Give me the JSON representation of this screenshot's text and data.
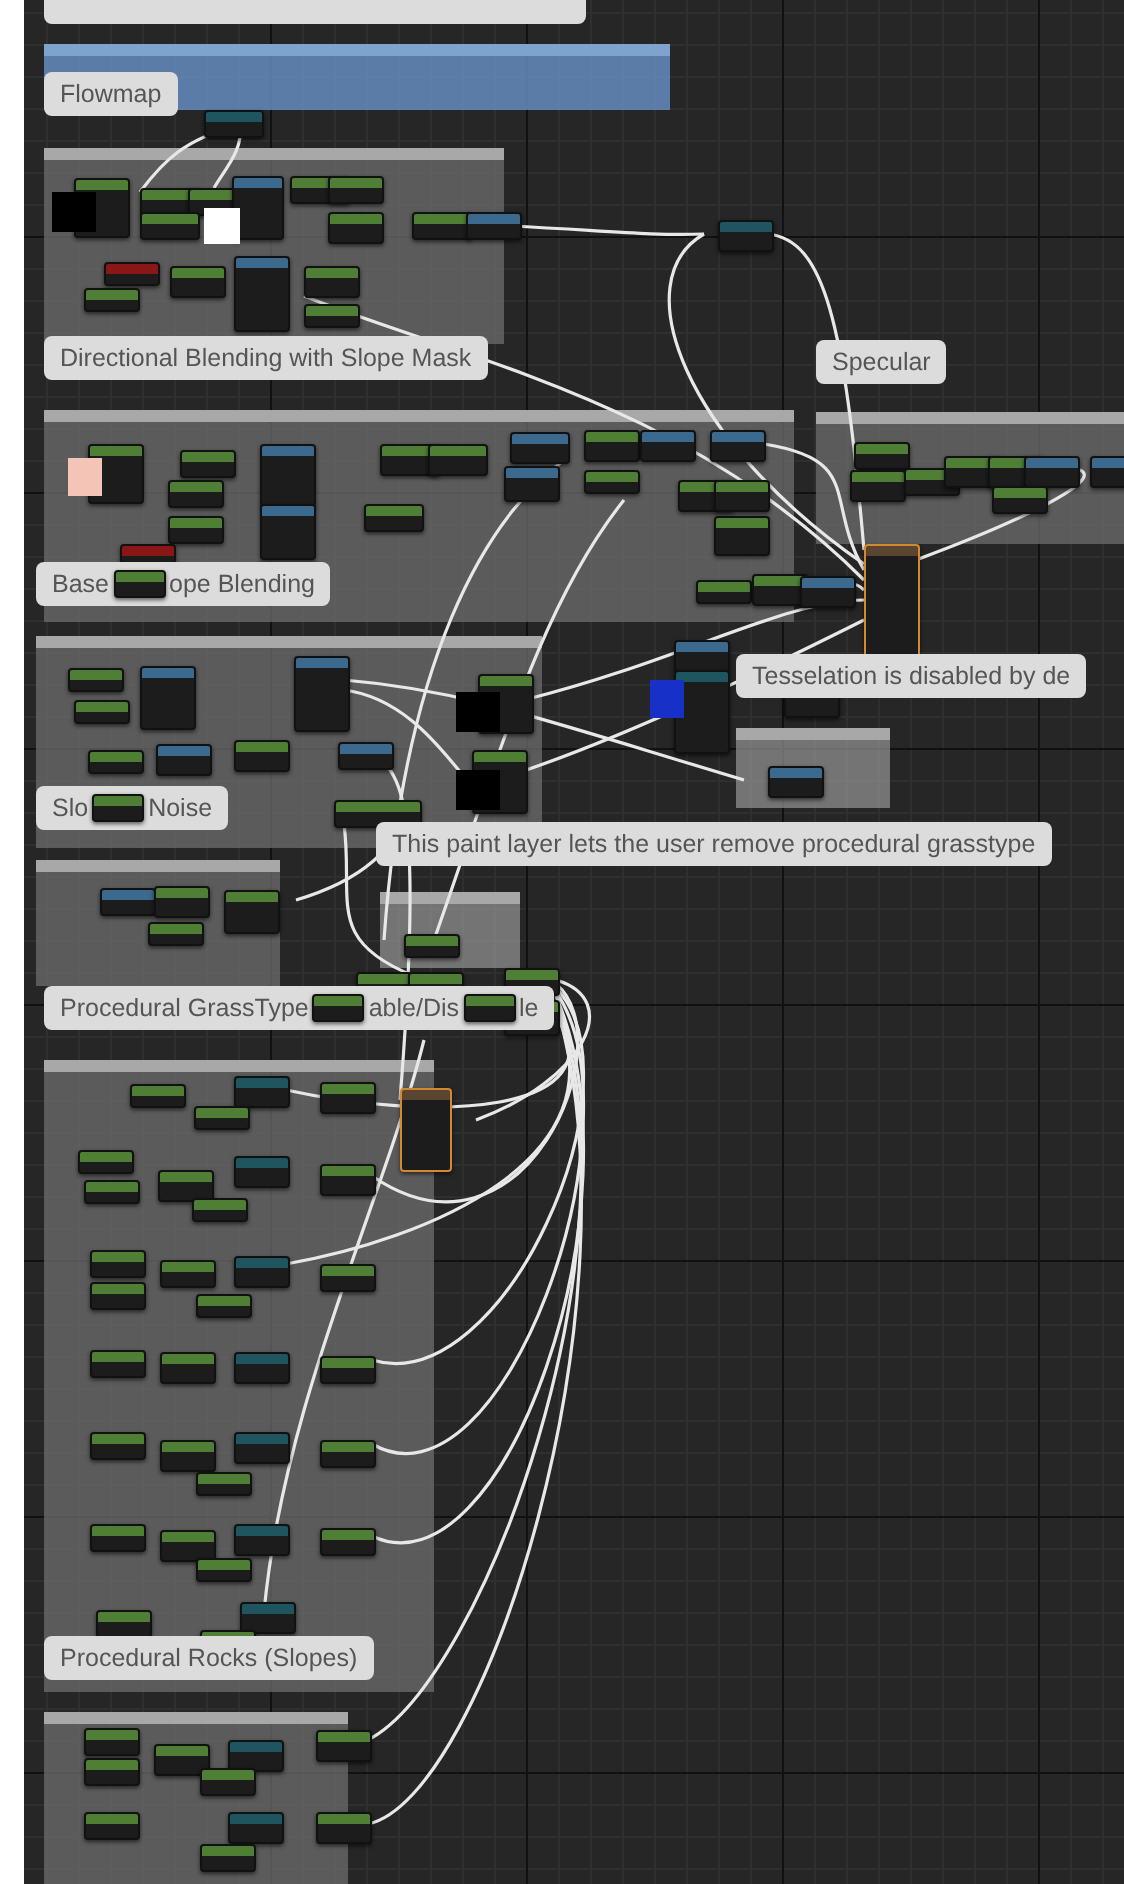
{
  "comments": [
    {
      "parts": [
        "Flowmap"
      ]
    },
    {
      "parts": [
        "Directional Blending with Slope Mask"
      ]
    },
    {
      "parts": [
        "Specular"
      ]
    },
    {
      "parts": [
        "Base",
        "ope Blending"
      ]
    },
    {
      "parts": [
        "Tesselation is disabled by de"
      ]
    },
    {
      "parts": [
        "Slo",
        "Noise"
      ]
    },
    {
      "parts": [
        "This paint layer lets the user remove procedural grasstype"
      ]
    },
    {
      "parts": [
        "Procedural GrassType",
        "able/Dis",
        "le"
      ]
    },
    {
      "parts": [
        "Procedural Rocks (Slopes)"
      ]
    }
  ]
}
